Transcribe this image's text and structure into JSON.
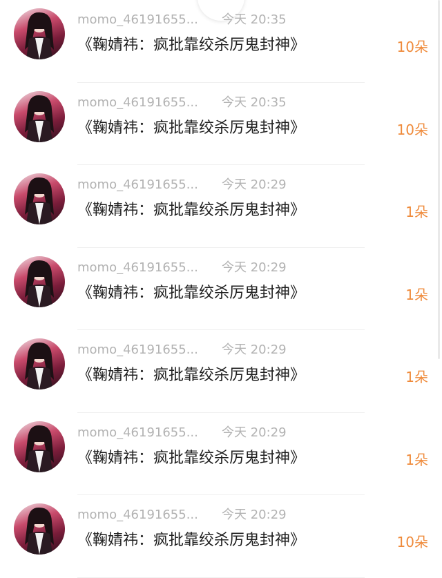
{
  "items": [
    {
      "username": "momo_46191655...",
      "time": "今天 20:35",
      "title": "《鞠婧祎：疯批靠绞杀厉鬼封神》",
      "gift": "10朵"
    },
    {
      "username": "momo_46191655...",
      "time": "今天 20:35",
      "title": "《鞠婧祎：疯批靠绞杀厉鬼封神》",
      "gift": "10朵"
    },
    {
      "username": "momo_46191655...",
      "time": "今天 20:29",
      "title": "《鞠婧祎：疯批靠绞杀厉鬼封神》",
      "gift": "1朵"
    },
    {
      "username": "momo_46191655...",
      "time": "今天 20:29",
      "title": "《鞠婧祎：疯批靠绞杀厉鬼封神》",
      "gift": "1朵"
    },
    {
      "username": "momo_46191655...",
      "time": "今天 20:29",
      "title": "《鞠婧祎：疯批靠绞杀厉鬼封神》",
      "gift": "1朵"
    },
    {
      "username": "momo_46191655...",
      "time": "今天 20:29",
      "title": "《鞠婧祎：疯批靠绞杀厉鬼封神》",
      "gift": "1朵"
    },
    {
      "username": "momo_46191655...",
      "time": "今天 20:29",
      "title": "《鞠婧祎：疯批靠绞杀厉鬼封神》",
      "gift": "10朵"
    }
  ],
  "colors": {
    "username": "#b2b2b2",
    "time": "#b2b2b2",
    "title": "#1f1f1f",
    "gift": "#ef8a3a"
  }
}
